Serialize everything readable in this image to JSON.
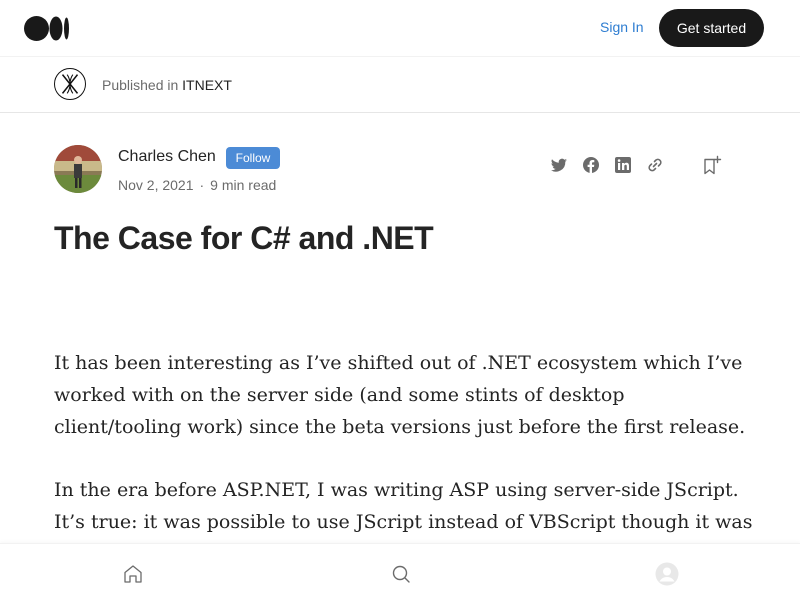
{
  "nav": {
    "sign_in": "Sign In",
    "get_started": "Get started"
  },
  "publication": {
    "prefix": "Published in",
    "name": "ITNEXT"
  },
  "author": {
    "name": "Charles Chen",
    "follow_label": "Follow",
    "date": "Nov 2, 2021",
    "separator": "·",
    "read_time": "9 min read"
  },
  "share_icons": [
    "twitter-icon",
    "facebook-icon",
    "linkedin-icon",
    "link-icon"
  ],
  "article": {
    "title": "The Case for C# and .NET",
    "paragraphs": [
      "It has been interesting as I’ve shifted out of .NET ecosystem which I’ve worked with on the server side (and some stints of desktop client/tooling work) since the beta versions just before the first release.",
      "In the era before ASP.NET, I was writing ASP using server-side JScript. It’s true: it was possible to use JScript instead of VBScript though it was rare to see in the"
    ]
  },
  "bottom_nav": [
    "home-icon",
    "search-icon",
    "profile-icon"
  ],
  "colors": {
    "accent_link": "#2e7dd1",
    "follow_button": "#4c8bd6",
    "dark_button": "#191919",
    "text": "#242424",
    "muted": "#6b6b6b"
  }
}
